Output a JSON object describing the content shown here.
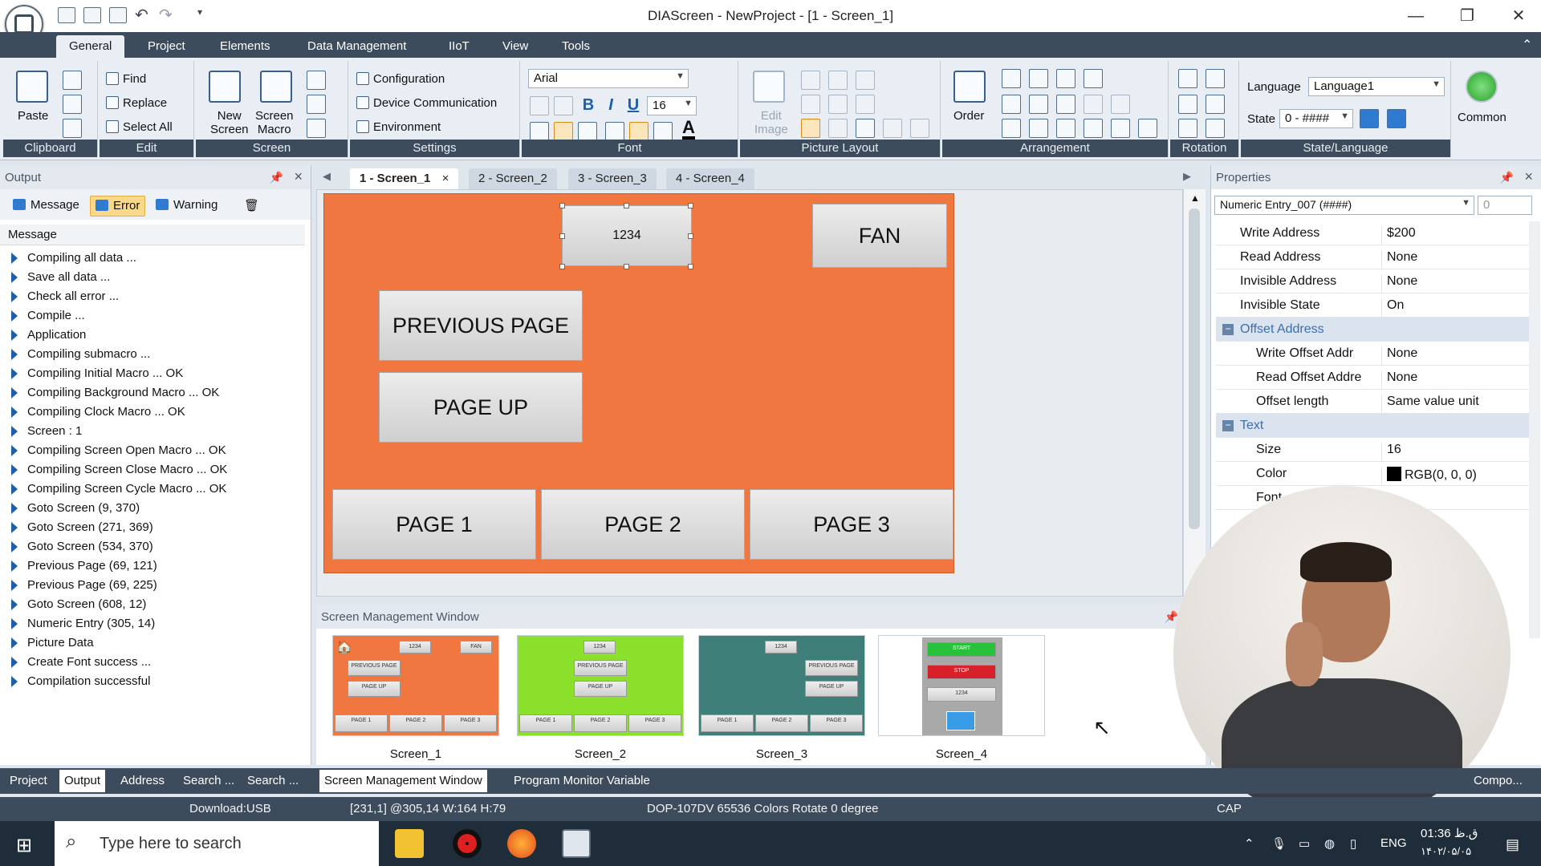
{
  "window": {
    "title": "DIAScreen - NewProject - [1 - Screen_1]",
    "minimize": "—",
    "restore": "❐",
    "close": "✕"
  },
  "ribbon_tabs": [
    "General",
    "Project",
    "Elements",
    "Data Management",
    "IIoT",
    "View",
    "Tools"
  ],
  "ribbon": {
    "clipboard": {
      "paste": "Paste",
      "group": "Clipboard"
    },
    "edit": {
      "find": "Find",
      "replace": "Replace",
      "select_all": "Select All",
      "group": "Edit"
    },
    "screen": {
      "new_screen_1": "New",
      "new_screen_2": "Screen",
      "screen_macro_1": "Screen",
      "screen_macro_2": "Macro",
      "group": "Screen"
    },
    "settings": {
      "configuration": "Configuration",
      "device_communication": "Device Communication",
      "environment": "Environment",
      "group": "Settings"
    },
    "font": {
      "family": "Arial",
      "size": "16",
      "bold": "B",
      "italic": "I",
      "underline": "U",
      "group": "Font"
    },
    "picture_layout": {
      "edit_image_1": "Edit",
      "edit_image_2": "Image",
      "group": "Picture Layout"
    },
    "arrangement": {
      "order": "Order",
      "group": "Arrangement"
    },
    "rotation": {
      "group": "Rotation"
    },
    "state_language": {
      "language_label": "Language",
      "language_value": "Language1",
      "state_label": "State",
      "state_value": "0 - ####",
      "group": "State/Language"
    },
    "common": {
      "label": "Common"
    }
  },
  "output_panel": {
    "title": "Output",
    "filters": [
      "Message",
      "Error",
      "Warning"
    ],
    "column": "Message",
    "messages": [
      "Compiling all data ...",
      "Save all data ...",
      "Check all error ...",
      "Compile ...",
      "Application",
      "Compiling submacro ...",
      "Compiling Initial Macro ... OK",
      "Compiling Background Macro ... OK",
      "Compiling Clock Macro ... OK",
      "Screen : 1",
      "Compiling Screen Open Macro ... OK",
      "Compiling Screen Close Macro ... OK",
      "Compiling Screen Cycle Macro ... OK",
      "Goto Screen (9, 370)",
      "Goto Screen (271, 369)",
      "Goto Screen (534, 370)",
      "Previous Page (69, 121)",
      "Previous Page (69, 225)",
      "Goto Screen (608, 12)",
      "Numeric Entry (305, 14)",
      "Picture Data",
      "Create Font success ...",
      "Compilation successful"
    ]
  },
  "doc_tabs": [
    "1 - Screen_1",
    "2 - Screen_2",
    "3 - Screen_3",
    "4 - Screen_4"
  ],
  "screen1": {
    "numeric_entry": "1234",
    "fan": "FAN",
    "previous_page": "PREVIOUS PAGE",
    "page_up": "PAGE UP",
    "page1": "PAGE 1",
    "page2": "PAGE 2",
    "page3": "PAGE 3",
    "bg_color": "#f07840"
  },
  "screen_management": {
    "title": "Screen Management Window",
    "screens": [
      "Screen_1",
      "Screen_2",
      "Screen_3",
      "Screen_4"
    ],
    "mini": {
      "num": "1234",
      "fan": "FAN",
      "prev": "PREVIOUS PAGE",
      "up": "PAGE UP",
      "p1": "PAGE 1",
      "p2": "PAGE 2",
      "p3": "PAGE 3",
      "start": "START",
      "stop": "STOP"
    },
    "colors": [
      "#f07840",
      "#8be02c",
      "#3f7f79",
      "#ffffff"
    ]
  },
  "properties": {
    "title": "Properties",
    "selector": "Numeric Entry_007 (####)",
    "selector_num": "0",
    "rows": [
      {
        "k": "Write Address",
        "v": "$200"
      },
      {
        "k": "Read Address",
        "v": "None"
      },
      {
        "k": "Invisible Address",
        "v": "None"
      },
      {
        "k": "Invisible State",
        "v": "On"
      }
    ],
    "cat_offset": "Offset Address",
    "offset_rows": [
      {
        "k": "Write Offset Addr",
        "v": "None"
      },
      {
        "k": "Read Offset Addre",
        "v": "None"
      },
      {
        "k": "Offset length",
        "v": "Same value unit"
      }
    ],
    "cat_text": "Text",
    "text_rows": [
      {
        "k": "Size",
        "v": "16"
      },
      {
        "k": "Color",
        "v": "RGB(0, 0, 0)"
      },
      {
        "k": "Font",
        "v": ""
      }
    ]
  },
  "bottom_tabs": {
    "left": [
      "Project",
      "Output",
      "Address",
      "Search ...",
      "Search ..."
    ],
    "mid": [
      "Screen Management Window",
      "Program Monitor Variable"
    ],
    "right": "Compo..."
  },
  "statusbar": {
    "download": "Download:USB",
    "coords": "[231,1] @305,14 W:164 H:79",
    "device": "DOP-107DV 65536 Colors Rotate 0 degree",
    "cap": "CAP"
  },
  "taskbar": {
    "search_placeholder": "Type here to search",
    "lang": "ENG",
    "time": "01:36 ق.ظ",
    "date": "۱۴۰۲/۰۵/۰۵"
  }
}
